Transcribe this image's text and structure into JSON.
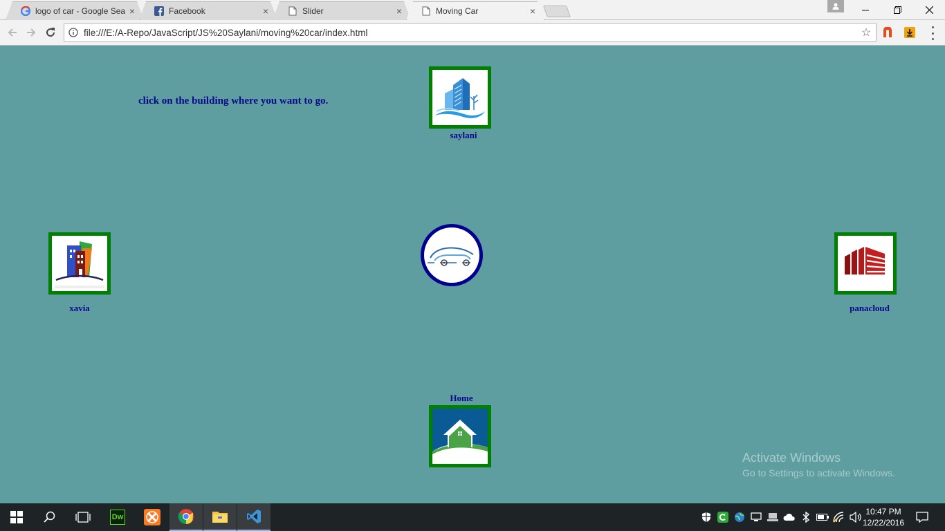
{
  "browser": {
    "tabs": [
      {
        "title": "logo of car - Google Sea",
        "icon": "google-icon",
        "active": false
      },
      {
        "title": "Facebook",
        "icon": "facebook-icon",
        "active": false
      },
      {
        "title": "Slider",
        "icon": "page-icon",
        "active": false
      },
      {
        "title": "Moving Car",
        "icon": "page-icon",
        "active": true
      }
    ],
    "close_glyph": "×",
    "url": "file:///E:/A-Repo/JavaScript/JS%20Saylani/moving%20car/index.html"
  },
  "page": {
    "instruction": "click on the building where you want to go.",
    "buildings": {
      "top": {
        "label": "saylani"
      },
      "left": {
        "label": "xavia"
      },
      "right": {
        "label": "panacloud"
      },
      "bottom": {
        "label": "Home"
      }
    }
  },
  "watermark": {
    "line1": "Activate Windows",
    "line2": "Go to Settings to activate Windows."
  },
  "taskbar": {
    "apps": [
      "Dw"
    ],
    "time": "10:47 PM",
    "date": "12/22/2016"
  },
  "colors": {
    "page_bg": "#5f9ea0",
    "building_border": "#008000",
    "label_text": "#08088a",
    "car_border": "#000090"
  }
}
